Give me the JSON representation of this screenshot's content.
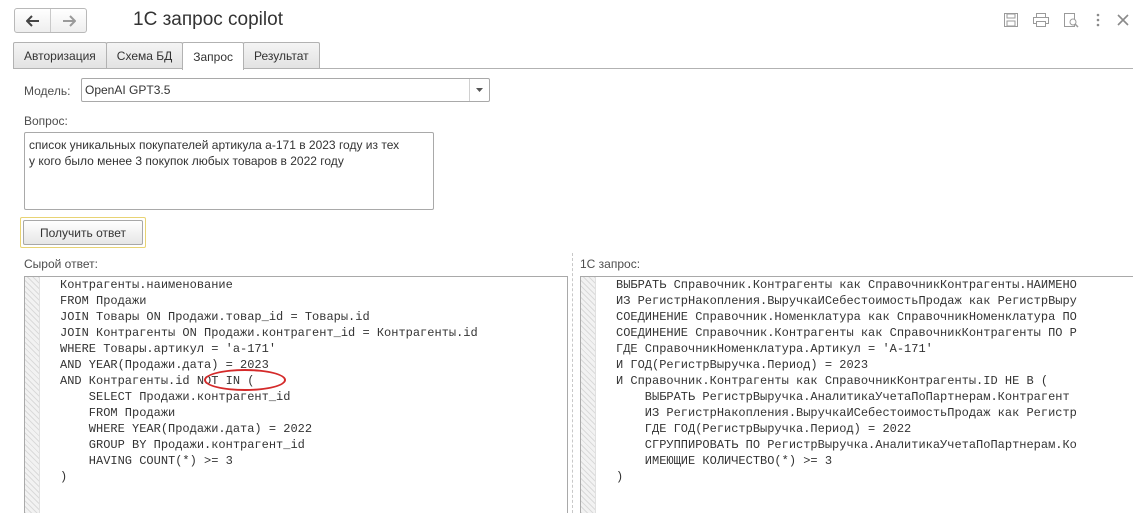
{
  "window": {
    "title": "1С запрос copilot"
  },
  "tabs": [
    {
      "label": "Авторизация",
      "active": false
    },
    {
      "label": "Схема БД",
      "active": false
    },
    {
      "label": "Запрос",
      "active": true
    },
    {
      "label": "Результат",
      "active": false
    }
  ],
  "form": {
    "model_label": "Модель:",
    "model_value": "OpenAI GPT3.5",
    "question_label": "Вопрос:",
    "question_text": "список уникальных покупателей артикула а-171 в 2023 году из тех\nу кого было менее 3 покупок любых товаров в 2022 году",
    "submit_label": "Получить ответ"
  },
  "raw_answer": {
    "label": "Сырой ответ:",
    "lines": [
      "Контрагенты.наименование",
      "FROM Продажи",
      "JOIN Товары ON Продажи.товар_id = Товары.id",
      "JOIN Контрагенты ON Продажи.контрагент_id = Контрагенты.id",
      "WHERE Товары.артикул = 'а-171'",
      "AND YEAR(Продажи.дата) = 2023",
      "AND Контрагенты.id NOT IN (",
      "    SELECT Продажи.контрагент_id",
      "    FROM Продажи",
      "    WHERE YEAR(Продажи.дата) = 2022",
      "    GROUP BY Продажи.контрагент_id",
      "    HAVING COUNT(*) >= 3",
      ")"
    ]
  },
  "query_1c": {
    "label": "1С запрос:",
    "lines": [
      "ВЫБРАТЬ Справочник.Контрагенты как СправочникКонтрагенты.НАИМЕНО",
      "ИЗ РегистрНакопления.ВыручкаИСебестоимостьПродаж как РегистрВыру",
      "СОЕДИНЕНИЕ Справочник.Номенклатура как СправочникНоменклатура ПО",
      "СОЕДИНЕНИЕ Справочник.Контрагенты как СправочникКонтрагенты ПО Р",
      "ГДЕ СправочникНоменклатура.Артикул = 'А-171'",
      "И ГОД(РегистрВыручка.Период) = 2023",
      "И Справочник.Контрагенты как СправочникКонтрагенты.ID НЕ В (",
      "    ВЫБРАТЬ РегистрВыручка.АналитикаУчетаПоПартнерам.Контрагент",
      "    ИЗ РегистрНакопления.ВыручкаИСебестоимостьПродаж как Регистр",
      "    ГДЕ ГОД(РегистрВыручка.Период) = 2022",
      "    СГРУППИРОВАТЬ ПО РегистрВыручка.АналитикаУчетаПоПартнерам.Ко",
      "    ИМЕЮЩИЕ КОЛИЧЕСТВО(*) >= 3",
      ")"
    ]
  },
  "annotation": {
    "color": "#d42a2a",
    "target_text": "NOT IN ("
  }
}
